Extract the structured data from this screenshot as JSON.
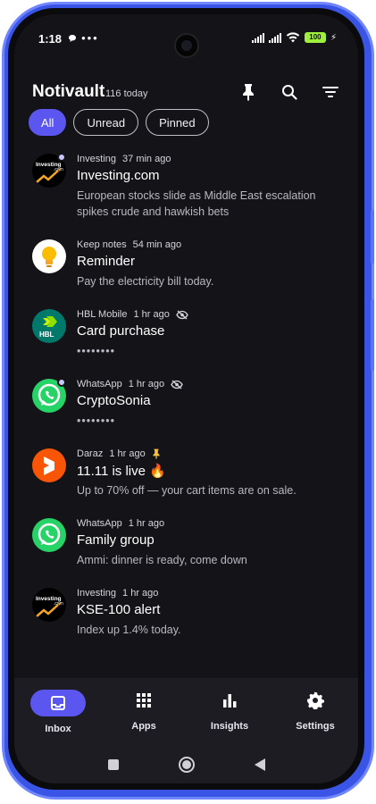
{
  "status_bar": {
    "time": "1:18",
    "battery": "100"
  },
  "app": {
    "title": "Notivault",
    "count_label": "116 today"
  },
  "filters": [
    {
      "label": "All",
      "active": true
    },
    {
      "label": "Unread",
      "active": false
    },
    {
      "label": "Pinned",
      "active": false
    }
  ],
  "notifications": [
    {
      "app": "Investing",
      "time": "37 min ago",
      "title": "Investing.com",
      "body": "European stocks slide as Middle East escalation spikes crude and hawkish bets",
      "icon": "investing-logo",
      "unread": true
    },
    {
      "app": "Keep notes",
      "time": "54 min ago",
      "title": "Reminder",
      "body": "Pay the electricity bill today.",
      "icon": "keep-bulb-icon",
      "unread": false
    },
    {
      "app": "HBL Mobile",
      "time": "1 hr ago",
      "title": "Card purchase",
      "body": "••••••••",
      "icon": "hbl-logo",
      "hidden": true
    },
    {
      "app": "WhatsApp",
      "time": "1 hr ago",
      "title": "CryptoSonia",
      "body": "••••••••",
      "icon": "whatsapp-icon",
      "hidden": true,
      "unread": true
    },
    {
      "app": "Daraz",
      "time": "1 hr ago",
      "title": "11.11 is live 🔥",
      "body": "Up to 70% off — your cart items are on sale.",
      "icon": "daraz-logo",
      "pinned": true
    },
    {
      "app": "WhatsApp",
      "time": "1 hr ago",
      "title": "Family group",
      "body": "Ammi: dinner is ready, come down",
      "icon": "whatsapp-icon"
    },
    {
      "app": "Investing",
      "time": "1 hr ago",
      "title": "KSE-100 alert",
      "body": "Index up 1.4% today.",
      "icon": "investing-logo"
    }
  ],
  "bottom_nav": [
    {
      "label": "Inbox",
      "icon": "inbox-icon",
      "active": true
    },
    {
      "label": "Apps",
      "icon": "grid-icon"
    },
    {
      "label": "Insights",
      "icon": "bar-chart-icon"
    },
    {
      "label": "Settings",
      "icon": "gear-icon"
    }
  ],
  "logo_text": {
    "investing": "Investing",
    "investing_sub": ".com",
    "hbl": "HBL"
  },
  "colors": {
    "accent": "#5b56f0",
    "background": "#141418",
    "whatsapp": "#25d366",
    "daraz": "#f85606",
    "hbl": "#00796b"
  }
}
